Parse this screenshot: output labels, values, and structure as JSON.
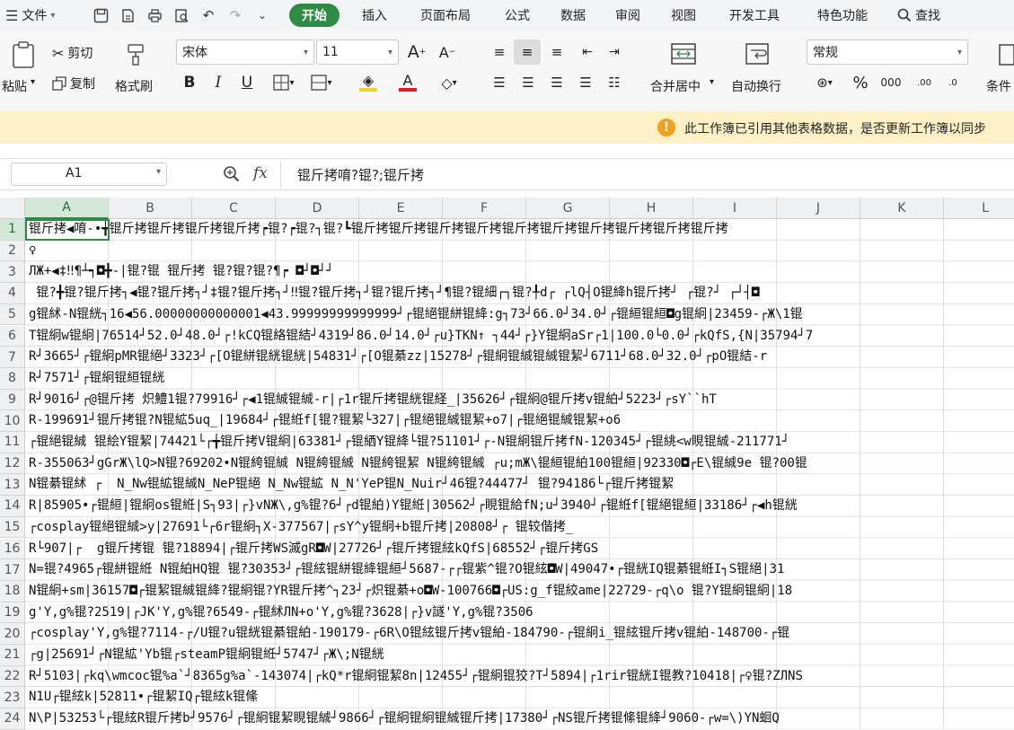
{
  "menu": {
    "file_label": "文件",
    "tabs": [
      "开始",
      "插入",
      "页面布局",
      "公式",
      "数据",
      "审阅",
      "视图",
      "开发工具",
      "特色功能"
    ],
    "active_tab": "开始",
    "search_label": "查找"
  },
  "ribbon": {
    "paste_label": "粘贴",
    "cut_label": "剪切",
    "copy_label": "复制",
    "format_painter_label": "格式刷",
    "font_name": "宋体",
    "font_size": "11",
    "merge_label": "合并居中",
    "wrap_label": "自动换行",
    "number_format": "常规",
    "cond_label": "条件"
  },
  "notice": {
    "text": "此工作簿已引用其他表格数据，是否更新工作簿以同步"
  },
  "formula_bar": {
    "cell_ref": "A1",
    "fx": "fx",
    "content": "锟斤拷唷?锟?;锟斤拷"
  },
  "sheet": {
    "columns": [
      "A",
      "B",
      "C",
      "D",
      "E",
      "F",
      "G",
      "H",
      "I",
      "J",
      "K",
      "L"
    ],
    "rows": [
      {
        "n": "1",
        "text": "锟斤拷◀唷-•╈锟斤拷锟斤拷锟斤拷锟斤拷┍锟?┍锟?┐锟?┗锟斤拷锟斤拷锟斤拷锟斤拷锟斤拷锟斤拷锟斤拷锟斤拷锟斤拷锟斤拷"
      },
      {
        "n": "2",
        "text": "♀"
      },
      {
        "n": "3",
        "text": "ЛЖ+◀‡‼¶┴┑◘╋-|锟?锟 锟斤拷 锟?锟?锟?¶┍ ◘┘◘┘┘"
      },
      {
        "n": "4",
        "text": " 锟?╋锟?锟斤拷┐◀锟?锟斤拷┐┘‡锟?锟斤拷┐┘‼锟?锟斤拷┐┘锟?锟斤拷┐┘¶锟?锟細┌┐锟?╀d┌ ┌lQ┤O锟絳h锟斤拷┘ ┌锟?┘ ┌┘┤◘"
      },
      {
        "n": "5",
        "text": "g锟絉-N锟絖┐16◀56.00000000000001◀43.99999999999999┘┌锟絕锟絣锟絳:g┐73┘66.0┘34.0┘┌锟絙锟絙◘g锟絅|23459-┌Ж\\1锟"
      },
      {
        "n": "6",
        "text": "T锟絅w锟絅|76514┘52.0┘48.0┘┌!kCQ锟絡锟結┘4319┘86.0┘14.0┘┌u}TKN↑ ┐44┘┌}Y锟絅aSr┌1|100.0└0.0┘┌kQfS,{N|35794┘7"
      },
      {
        "n": "7",
        "text": "R┘3665┘┌锟絅pMR锟絕┘3323┘┌[O锟絣锟絖锟絖|54831┘┌[O锟綦zz|15278┘┌锟絅锟絾锟絾锟絜┘6711┘68.0┘32.0┘┌pO锟結-r"
      },
      {
        "n": "8",
        "text": "R┘7571┘┌锟絅锟絙锟絖"
      },
      {
        "n": "9",
        "text": "R┘9016┘┌@锟斤拷 炽鱧1锟?79916┘┌◀1锟絾锟絾-r|┌1r锟斤拷锟絖锟経_|35626┘┌锟絅@锟斤拷v锟絈┘5223┘┌sY``hT"
      },
      {
        "n": "10",
        "text": "R-199691┘锟斤拷锟?N锟絋5uq_|19684┘┌锟絍f[锟?锟絜└327|┌锟絕锟絾锟絜+o7|┌锟絕锟絾锟絜+o6"
      },
      {
        "n": "11",
        "text": "┌锟絕锟絾 锟絵Y锟絜|74421└┌╈锟斤拷V锟絅|63381┘┌锟絤Y锟絳└锟?51101┘┌-N锟絅锟斤拷fN-120345┘┌锟絩<w睍锟絾-211771┘"
      },
      {
        "n": "12",
        "text": "R-355063┘gGrЖ\\lQ>N锟?69202•N锟絝锟絾 N锟絝锟絾 N锟絝锟絜 N锟絝锟絾 ┌u;mЖ\\锟絙锟絈100锟絙|92330◘┌E\\锟絾9e 锟?00锟"
      },
      {
        "n": "13",
        "text": "N锟綦锟絉 ┌  N_Nw锟絋锟絾N_NeP锟絕 N_Nw锟絋 N_N'YeP锟N_Nuir┘46锟?44477┘ 锟?94186└┌锟斤拷锟絜"
      },
      {
        "n": "14",
        "text": "R|85905•┌锟絙|锟絅os锟絍|S┐93|┌}vNЖ\\,g%锟?6┘┌d锟絈)Y锟絍|30562┘┌睍锟給fN;u┘3940┘┌锟絍f[锟絕锟絙|33186┘┌◀h锟絖"
      },
      {
        "n": "15",
        "text": "┌cosplay锟絕锟絾>y|27691└┌6r锟絅┐X-377567|┌sY^y锟絅+b锟斤拷|20808┘┌ 锟较偕拷_"
      },
      {
        "n": "16",
        "text": "R└907|┌  g锟斤拷锟 锟?18894|┌锟斤拷WS滅gR◘W|27726┘┌锟斤拷锟絃kQfS|68552┘┌锟斤拷GS"
      },
      {
        "n": "17",
        "text": "N=锟?4965┌锟絣锟絍 N锟絈HQ锟 锟?30353┘┌锟絃锟絣锟絳锟絙┘5687-┌┌锟紫^锟?O锟絃◘W|49047•┌锟絖IQ锟綦锟絍I┐S锟絕|31"
      },
      {
        "n": "18",
        "text": "N锟絅+sm|36157◘┌锟絜锟絾锟絳?锟絅锟?YR锟斤拷^┐23┘┌炽锟綦+o◘W-100766◘┌US:g_f锟絞ame|22729-┌q\\o 锟?Y锟絅锟絅|18"
      },
      {
        "n": "19",
        "text": "g'Y,g%锟?2519|┌JK'Y,g%锟?6549-┌锟絉ЛN+o'Y,g%锟?3628|┌}v譢'Y,g%锟?3506"
      },
      {
        "n": "20",
        "text": "┌cosplay'Y,g%锟?7114-┌/U锟?u锟絖锟綦锟絈-190179-┌6R\\O锟絃锟斤拷v锟絈-184790-┌锟絅i_锟絃锟斤拷v锟絈-148700-┌锟"
      },
      {
        "n": "21",
        "text": "┌g|25691┘┌N锟絋'Yb锟┌steamP锟絅锟絍┘5747┘┌Ж\\;N锟絖"
      },
      {
        "n": "22",
        "text": "R┘5103|┌kq\\wmcoc锟%a`┘8365g%a`-143074|┌kQ*r锟絅锟絜8n|12455┘┌锟絅锟狡?T┘5894|┌1rir锟絖I锟教?10418|┌♀锟?ZЛNS"
      },
      {
        "n": "23",
        "text": "N1U┌锟絃k|52811•┌锟絜IQ┌锟絃k锟絛"
      },
      {
        "n": "24",
        "text": "N\\P|53253└┌锟絃R锟斤拷b┘9576┘┌锟絅锟絜睍锟絾┘9866┘┌锟絅锟絅锟絾锟斤拷|17380┘┌NS锟斤拷锟絛锟絳┘9060-┌w=\\)YN蛔Q"
      }
    ]
  }
}
